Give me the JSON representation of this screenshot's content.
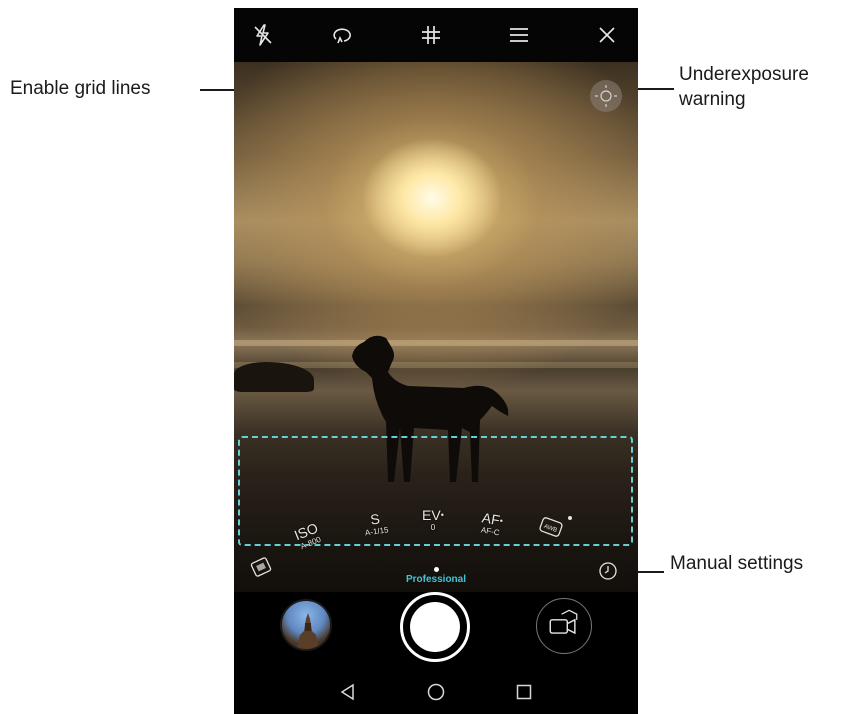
{
  "annotations": {
    "grid_lines": "Enable grid lines",
    "underexposure_line1": "Underexposure",
    "underexposure_line2": "warning",
    "manual_settings": "Manual settings"
  },
  "top_bar": {
    "icons": [
      "flash-off-icon",
      "beauty-capture-icon",
      "grid-icon",
      "menu-icon",
      "close-icon"
    ]
  },
  "manual_settings": {
    "iso": {
      "label": "ISO",
      "value": "A-800"
    },
    "shutter": {
      "label": "S",
      "value": "A-1/15"
    },
    "ev": {
      "label": "EV",
      "value": "0"
    },
    "af": {
      "label": "AF",
      "value": "AF-C"
    },
    "wb_label": "AWB"
  },
  "mode": {
    "label": "Professional"
  },
  "colors": {
    "accent": "#3fc6d6",
    "annotation_box": "#66cfd6"
  }
}
